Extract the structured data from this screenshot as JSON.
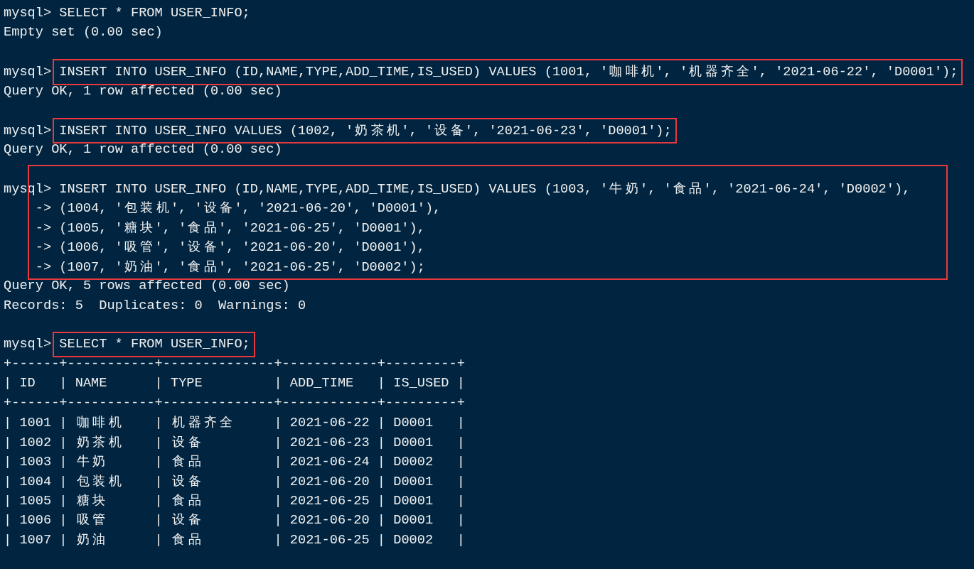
{
  "terminal": {
    "blocks": [
      {
        "kind": "command",
        "highlighted": false,
        "lines": [
          {
            "prompt": "mysql>",
            "text": "SELECT * FROM USER_INFO;"
          }
        ]
      },
      {
        "kind": "output",
        "lines": [
          "Empty set (0.00 sec)"
        ]
      },
      {
        "kind": "blank"
      },
      {
        "kind": "command",
        "highlighted": true,
        "lines": [
          {
            "prompt": "mysql>",
            "text": "INSERT INTO USER_INFO (ID,NAME,TYPE,ADD_TIME,IS_USED) VALUES (1001, '咖啡机', '机器齐全', '2021-06-22', 'D0001');"
          }
        ]
      },
      {
        "kind": "output",
        "lines": [
          "Query OK, 1 row affected (0.00 sec)"
        ]
      },
      {
        "kind": "blank"
      },
      {
        "kind": "command",
        "highlighted": true,
        "lines": [
          {
            "prompt": "mysql>",
            "text": "INSERT INTO USER_INFO VALUES (1002, '奶茶机', '设备', '2021-06-23', 'D0001');"
          }
        ]
      },
      {
        "kind": "output",
        "lines": [
          "Query OK, 1 row affected (0.00 sec)"
        ]
      },
      {
        "kind": "blank"
      },
      {
        "kind": "command",
        "highlighted": true,
        "lines": [
          {
            "prompt": "mysql>",
            "text": "INSERT INTO USER_INFO (ID,NAME,TYPE,ADD_TIME,IS_USED) VALUES (1003, '牛奶', '食品', '2021-06-24', 'D0002'),"
          },
          {
            "prompt": "->",
            "text": "(1004, '包装机', '设备', '2021-06-20', 'D0001'),"
          },
          {
            "prompt": "->",
            "text": "(1005, '糖块', '食品', '2021-06-25', 'D0001'),"
          },
          {
            "prompt": "->",
            "text": "(1006, '吸管', '设备', '2021-06-20', 'D0001'),"
          },
          {
            "prompt": "->",
            "text": "(1007, '奶油', '食品', '2021-06-25', 'D0002');"
          }
        ]
      },
      {
        "kind": "output",
        "lines": [
          "Query OK, 5 rows affected (0.00 sec)",
          "Records: 5  Duplicates: 0  Warnings: 0"
        ]
      },
      {
        "kind": "blank"
      },
      {
        "kind": "command",
        "highlighted": true,
        "lines": [
          {
            "prompt": "mysql>",
            "text": "SELECT * FROM USER_INFO;"
          }
        ]
      },
      {
        "kind": "table",
        "top_border": "+------+-----------+--------------+------------+---------+",
        "header": "| ID   | NAME      | TYPE         | ADD_TIME   | IS_USED |",
        "header_border": "+------+-----------+--------------+------------+---------+",
        "rows": [
          "| 1001 | 咖啡机    | 机器齐全     | 2021-06-22 | D0001   |",
          "| 1002 | 奶茶机    | 设备         | 2021-06-23 | D0001   |",
          "| 1003 | 牛奶      | 食品         | 2021-06-24 | D0002   |",
          "| 1004 | 包装机    | 设备         | 2021-06-20 | D0001   |",
          "| 1005 | 糖块      | 食品         | 2021-06-25 | D0001   |",
          "| 1006 | 吸管      | 设备         | 2021-06-20 | D0001   |",
          "| 1007 | 奶油      | 食品         | 2021-06-25 | D0002   |"
        ]
      }
    ]
  }
}
